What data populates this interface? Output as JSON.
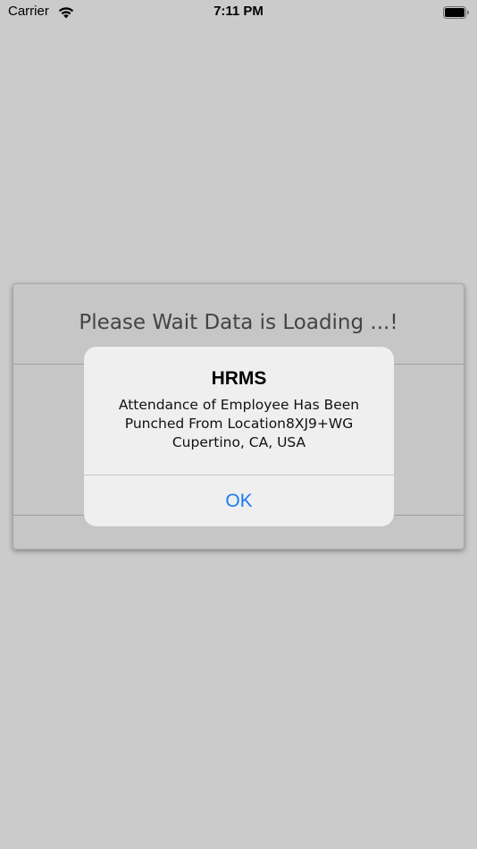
{
  "status_bar": {
    "carrier": "Carrier",
    "time": "7:11 PM"
  },
  "loading_card": {
    "text": "Please Wait Data is Loading ...!"
  },
  "alert": {
    "title": "HRMS",
    "message": "Attendance of Employee Has Been\nPunched From Location8XJ9+WG\nCupertino, CA, USA",
    "ok_label": "OK"
  },
  "colors": {
    "background": "#cbcbcb",
    "alert_background": "#efefef",
    "accent": "#1a7cf0"
  },
  "icons": {
    "wifi": "wifi-icon",
    "battery": "battery-icon"
  }
}
